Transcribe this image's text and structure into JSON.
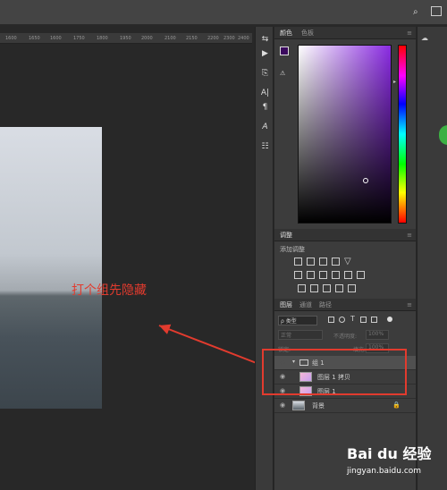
{
  "ruler": {
    "ticks": [
      "1600",
      "1650",
      "1600",
      "1750",
      "1800",
      "1950",
      "2000",
      "2100",
      "2150",
      "2200",
      "2300",
      "2400"
    ]
  },
  "annotation": {
    "text": "打个组先隐藏"
  },
  "tools": [
    "A|",
    "¶",
    "A",
    "☷"
  ],
  "color_panel": {
    "tab_color": "颜色",
    "tab_swatches": "色板"
  },
  "adjust_panel": {
    "tab": "调整",
    "subtitle": "添加调整"
  },
  "layers_panel": {
    "tab_layers": "图层",
    "tab_channels": "通道",
    "tab_paths": "路径",
    "filter_kind": "ρ 类型",
    "blend_mode": "正常",
    "opacity_label": "不透明度:",
    "opacity_value": "100%",
    "lock_label": "锁定:",
    "fill_label": "填充:",
    "fill_value": "100%",
    "layers": [
      {
        "name": "组 1",
        "type": "group"
      },
      {
        "name": "图层 1 拷贝",
        "type": "layer"
      },
      {
        "name": "图层 1",
        "type": "layer"
      },
      {
        "name": "背景",
        "type": "background"
      }
    ]
  },
  "watermark": {
    "brand": "Bai du 经验",
    "url": "jingyan.baidu.com"
  },
  "colors": {
    "accent_red": "#e23b2e",
    "panel_bg": "#3c3c3c"
  }
}
